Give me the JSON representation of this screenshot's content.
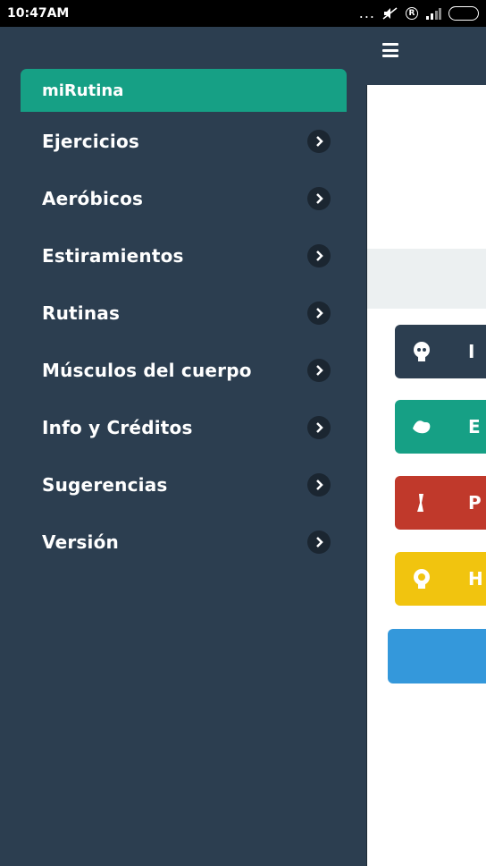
{
  "status_bar": {
    "time": "10:47AM",
    "dots": "...",
    "registered": "R"
  },
  "drawer": {
    "header": "miRutina",
    "items": [
      {
        "label": "Ejercicios"
      },
      {
        "label": "Aeróbicos"
      },
      {
        "label": "Estiramientos"
      },
      {
        "label": "Rutinas"
      },
      {
        "label": "Músculos del cuerpo"
      },
      {
        "label": "Info y Créditos"
      },
      {
        "label": "Sugerencias"
      },
      {
        "label": "Versión"
      }
    ]
  },
  "content": {
    "category_buttons": [
      {
        "letter": "I",
        "color": "#2c3e50",
        "icon": "brain-icon"
      },
      {
        "letter": "E",
        "color": "#16a085",
        "icon": "bicep-icon"
      },
      {
        "letter": "P",
        "color": "#c0392b",
        "icon": "leg-icon"
      },
      {
        "letter": "H",
        "color": "#f1c40f",
        "icon": "head-icon"
      }
    ]
  },
  "colors": {
    "drawer_bg": "#2c3e50",
    "header_green": "#16a085",
    "chevron_bg": "#1b2631",
    "accent_blue": "#3498db"
  }
}
